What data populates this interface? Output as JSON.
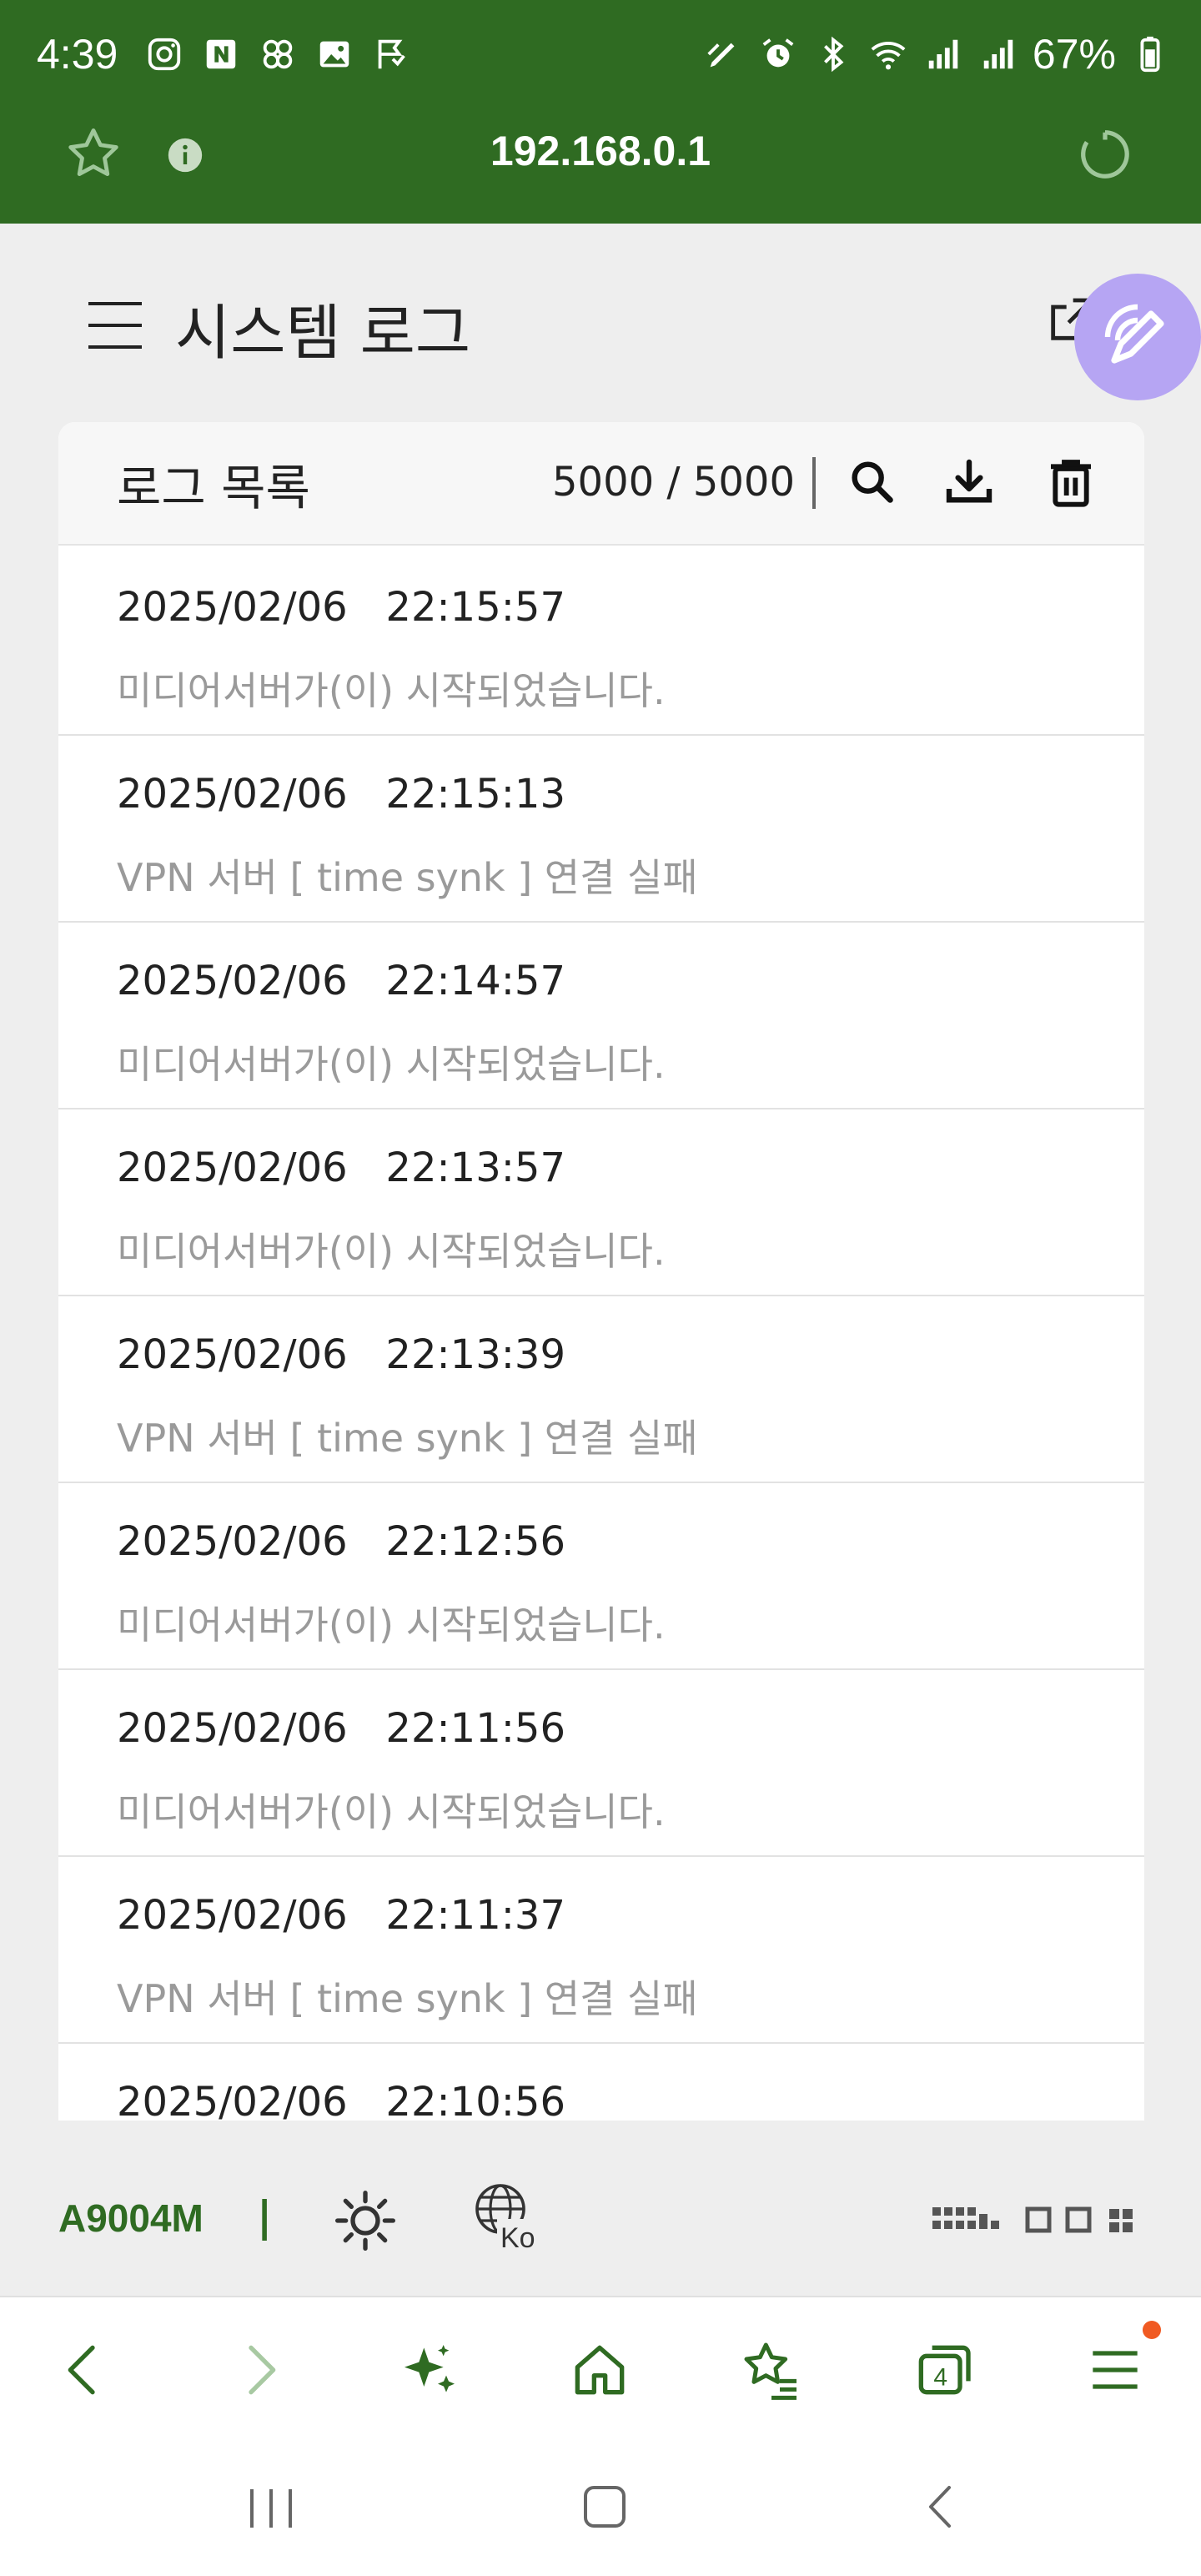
{
  "status_bar": {
    "time": "4:39",
    "battery": "67%",
    "left_icons": [
      "instagram-icon",
      "naver-icon",
      "pinwheel-icon",
      "gallery-icon",
      "sign-icon"
    ],
    "right_icons": [
      "pen-icon",
      "alarm-icon",
      "bluetooth-icon",
      "wifi-icon",
      "signal-icon",
      "signal-icon",
      "battery-icon"
    ]
  },
  "browser": {
    "url": "192.168.0.1"
  },
  "page": {
    "title": "시스템 로그"
  },
  "log_card": {
    "title": "로그 목록",
    "count": "5000 / 5000",
    "entries": [
      {
        "time": "2025/02/06   22:15:57",
        "message": "미디어서버가(이) 시작되었습니다."
      },
      {
        "time": "2025/02/06   22:15:13",
        "message": "VPN 서버 [ time synk ] 연결 실패"
      },
      {
        "time": "2025/02/06   22:14:57",
        "message": "미디어서버가(이) 시작되었습니다."
      },
      {
        "time": "2025/02/06   22:13:57",
        "message": "미디어서버가(이) 시작되었습니다."
      },
      {
        "time": "2025/02/06   22:13:39",
        "message": "VPN 서버 [ time synk ] 연결 실패"
      },
      {
        "time": "2025/02/06   22:12:56",
        "message": "미디어서버가(이) 시작되었습니다."
      },
      {
        "time": "2025/02/06   22:11:56",
        "message": "미디어서버가(이) 시작되었습니다."
      },
      {
        "time": "2025/02/06   22:11:37",
        "message": "VPN 서버 [ time synk ] 연결 실패"
      },
      {
        "time": "2025/02/06   22:10:56",
        "message": ""
      }
    ]
  },
  "footer": {
    "model": "A9004M",
    "separator": "|",
    "lang_code": "Ko"
  },
  "colors": {
    "brand_green": "#2f6b22",
    "fab_purple": "#b6a5f3",
    "notification": "#f05a22"
  }
}
